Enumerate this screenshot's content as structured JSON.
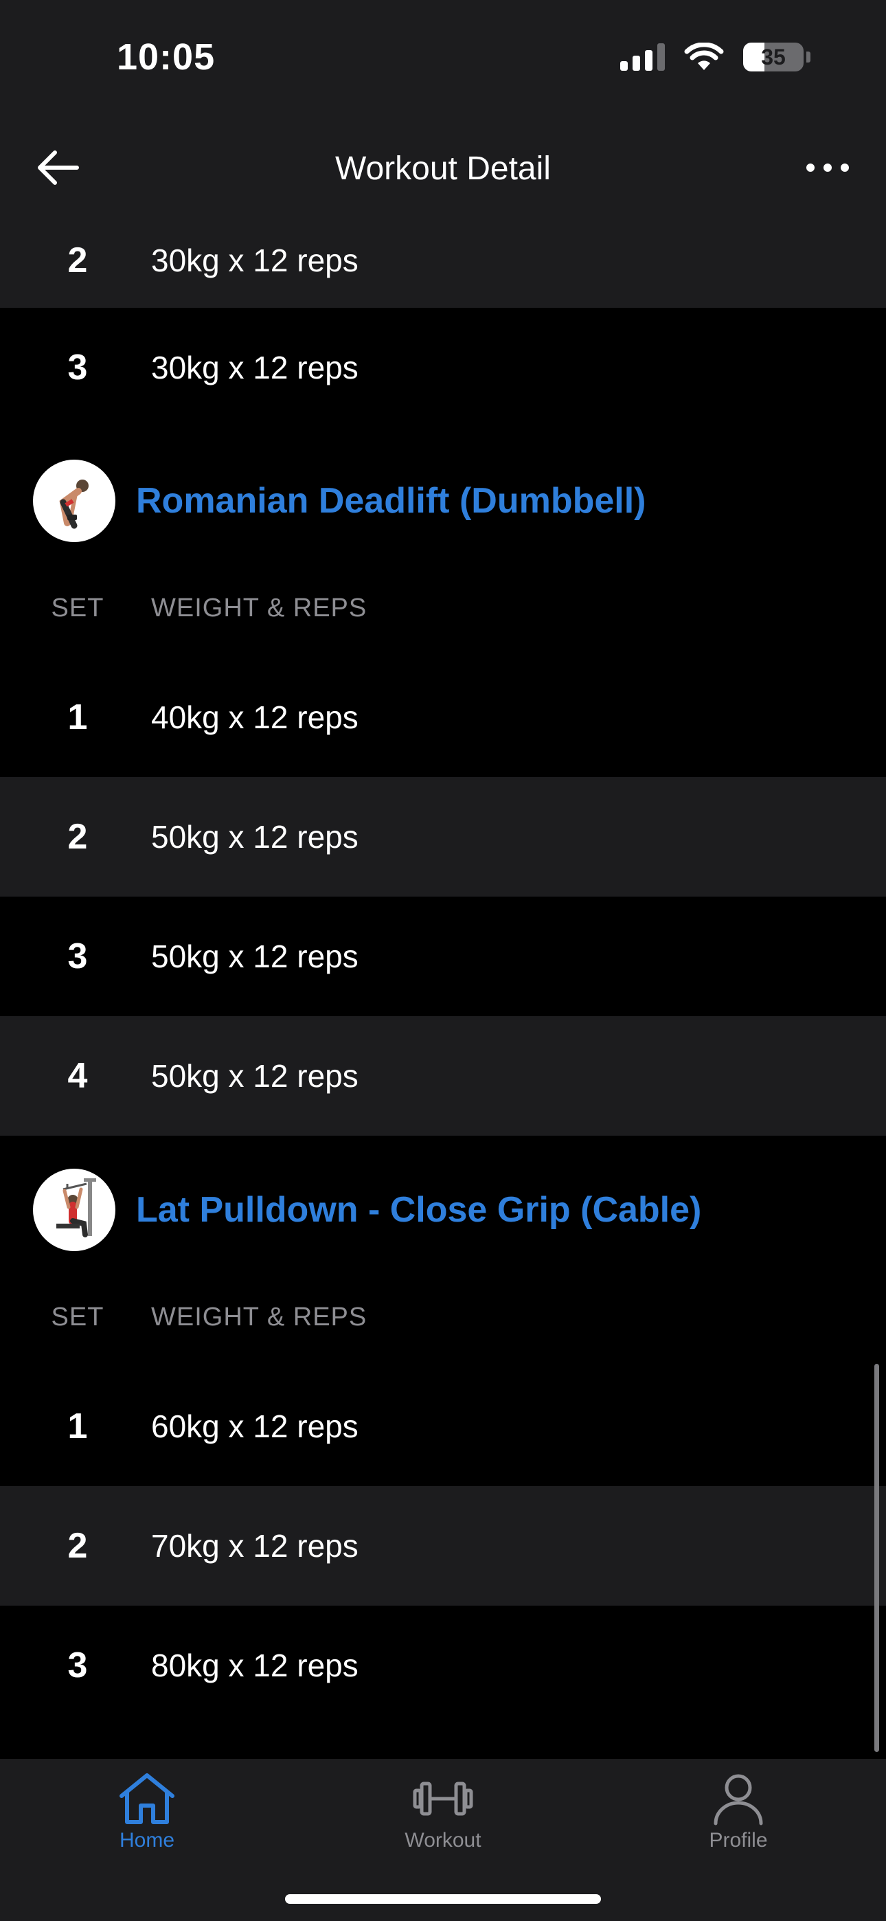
{
  "status_bar": {
    "time": "10:05",
    "battery_level": "35"
  },
  "nav": {
    "title": "Workout Detail"
  },
  "column_headers": {
    "set": "SET",
    "weight_reps": "WEIGHT & REPS"
  },
  "prev_exercise_sets": [
    {
      "set": "2",
      "value": "30kg x 12 reps"
    },
    {
      "set": "3",
      "value": "30kg x 12 reps"
    }
  ],
  "exercises": [
    {
      "name": "Romanian Deadlift (Dumbbell)",
      "sets": [
        {
          "set": "1",
          "value": "40kg x 12 reps"
        },
        {
          "set": "2",
          "value": "50kg x 12 reps"
        },
        {
          "set": "3",
          "value": "50kg x 12 reps"
        },
        {
          "set": "4",
          "value": "50kg x 12 reps"
        }
      ]
    },
    {
      "name": "Lat Pulldown - Close Grip (Cable)",
      "sets": [
        {
          "set": "1",
          "value": "60kg x 12 reps"
        },
        {
          "set": "2",
          "value": "70kg x 12 reps"
        },
        {
          "set": "3",
          "value": "80kg x 12 reps"
        }
      ]
    }
  ],
  "tabs": [
    {
      "label": "Home",
      "icon": "home-icon",
      "active": true
    },
    {
      "label": "Workout",
      "icon": "dumbbell-icon",
      "active": false
    },
    {
      "label": "Profile",
      "icon": "profile-icon",
      "active": false
    }
  ],
  "colors": {
    "accent": "#2f7fdc",
    "background": "#000000",
    "surface": "#1c1c1e",
    "muted": "#8e8e93"
  }
}
